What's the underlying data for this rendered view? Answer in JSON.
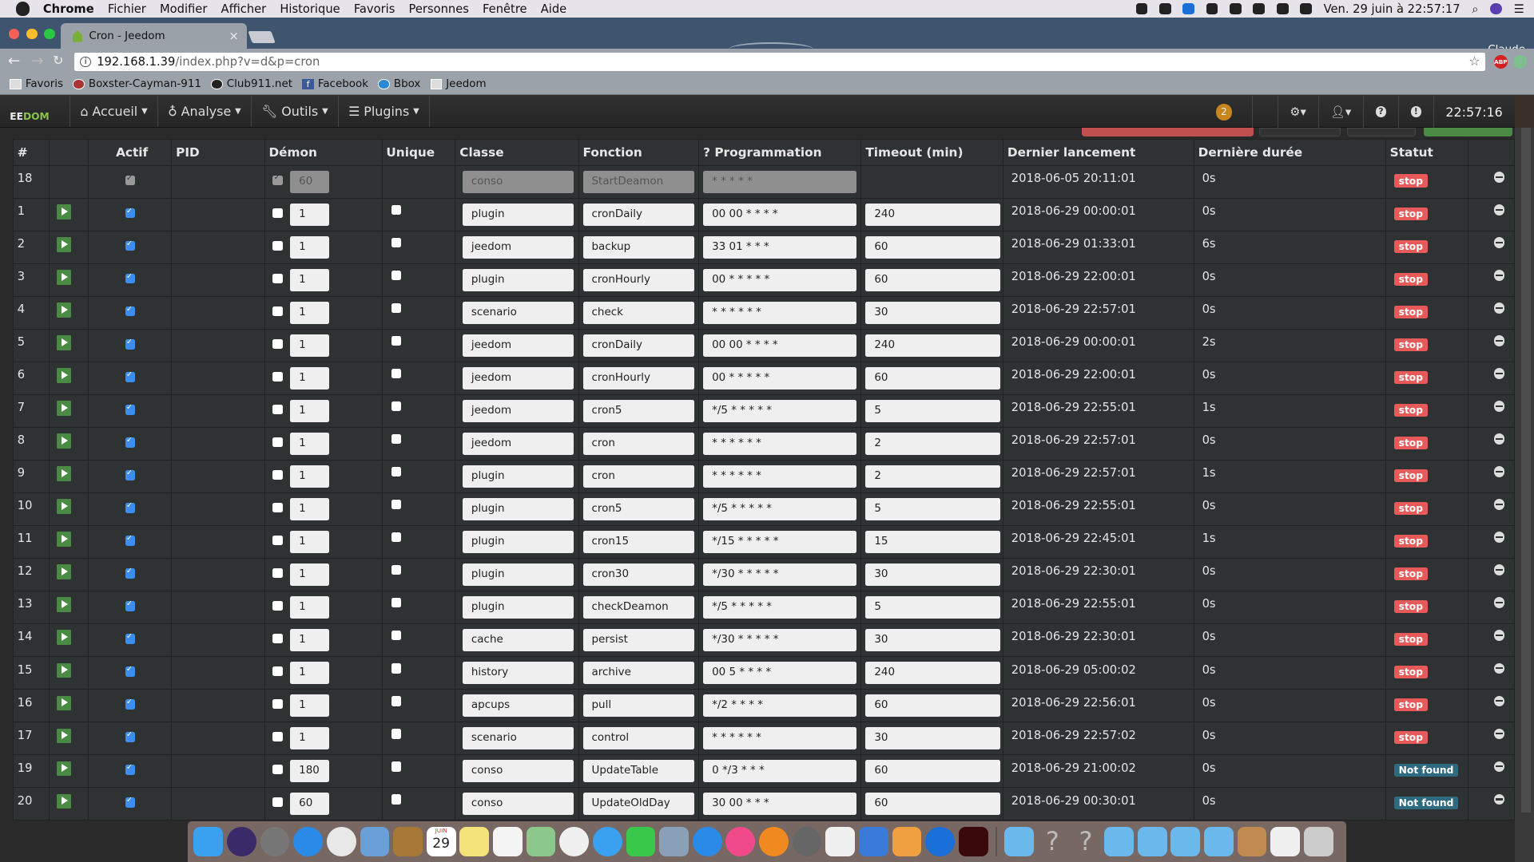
{
  "menubar": {
    "app": "Chrome",
    "items": [
      "Fichier",
      "Modifier",
      "Afficher",
      "Historique",
      "Favoris",
      "Personnes",
      "Fenêtre",
      "Aide"
    ],
    "datetime": "Ven. 29 juin à  22:57:17"
  },
  "browser": {
    "tab_title": "Cron - Jeedom",
    "profile": "Claude",
    "url_host": "192.168.1.39",
    "url_path": "/index.php?v=d&p=cron",
    "extensions": [
      "ABP"
    ],
    "bookmarks": [
      "Favoris",
      "Boxster-Cayman-911",
      "Club911.net",
      "Facebook",
      "Bbox",
      "Jeedom"
    ]
  },
  "jeedom_nav": {
    "logo_a": "EE",
    "logo_b": "DOM",
    "items": [
      "Accueil",
      "Analyse",
      "Outils",
      "Plugins"
    ],
    "notification_count": "2",
    "clock": "22:57:16"
  },
  "colors": {
    "accent": "#8bc34a",
    "stop": "#e85a5a",
    "not_found": "#2e6a80",
    "play": "#4a8a44"
  },
  "table": {
    "headers": [
      "#",
      "",
      "Actif",
      "PID",
      "Démon",
      "Unique",
      "Classe",
      "Fonction",
      "Programmation",
      "Timeout (min)",
      "Dernier lancement",
      "Dernière durée",
      "Statut",
      ""
    ],
    "rows": [
      {
        "id": "18",
        "actif": true,
        "demon": true,
        "demon_val": "60",
        "unique": false,
        "classe": "conso",
        "fonction": "StartDeamon",
        "prog": "* * * * *",
        "timeout": "",
        "last": "2018-06-05 20:11:01",
        "duration": "0s",
        "status": "stop",
        "disabled": true
      },
      {
        "id": "1",
        "actif": true,
        "demon": false,
        "demon_val": "1",
        "unique": false,
        "classe": "plugin",
        "fonction": "cronDaily",
        "prog": "00 00 * * * *",
        "timeout": "240",
        "last": "2018-06-29 00:00:01",
        "duration": "0s",
        "status": "stop"
      },
      {
        "id": "2",
        "actif": true,
        "demon": false,
        "demon_val": "1",
        "unique": false,
        "classe": "jeedom",
        "fonction": "backup",
        "prog": "33 01 * * *",
        "timeout": "60",
        "last": "2018-06-29 01:33:01",
        "duration": "6s",
        "status": "stop"
      },
      {
        "id": "3",
        "actif": true,
        "demon": false,
        "demon_val": "1",
        "unique": false,
        "classe": "plugin",
        "fonction": "cronHourly",
        "prog": "00 * * * * *",
        "timeout": "60",
        "last": "2018-06-29 22:00:01",
        "duration": "0s",
        "status": "stop"
      },
      {
        "id": "4",
        "actif": true,
        "demon": false,
        "demon_val": "1",
        "unique": false,
        "classe": "scenario",
        "fonction": "check",
        "prog": "* * * * * *",
        "timeout": "30",
        "last": "2018-06-29 22:57:01",
        "duration": "0s",
        "status": "stop"
      },
      {
        "id": "5",
        "actif": true,
        "demon": false,
        "demon_val": "1",
        "unique": false,
        "classe": "jeedom",
        "fonction": "cronDaily",
        "prog": "00 00 * * * *",
        "timeout": "240",
        "last": "2018-06-29 00:00:01",
        "duration": "2s",
        "status": "stop"
      },
      {
        "id": "6",
        "actif": true,
        "demon": false,
        "demon_val": "1",
        "unique": false,
        "classe": "jeedom",
        "fonction": "cronHourly",
        "prog": "00 * * * * *",
        "timeout": "60",
        "last": "2018-06-29 22:00:01",
        "duration": "0s",
        "status": "stop"
      },
      {
        "id": "7",
        "actif": true,
        "demon": false,
        "demon_val": "1",
        "unique": false,
        "classe": "jeedom",
        "fonction": "cron5",
        "prog": "*/5 * * * * *",
        "timeout": "5",
        "last": "2018-06-29 22:55:01",
        "duration": "1s",
        "status": "stop"
      },
      {
        "id": "8",
        "actif": true,
        "demon": false,
        "demon_val": "1",
        "unique": false,
        "classe": "jeedom",
        "fonction": "cron",
        "prog": "* * * * * *",
        "timeout": "2",
        "last": "2018-06-29 22:57:01",
        "duration": "0s",
        "status": "stop"
      },
      {
        "id": "9",
        "actif": true,
        "demon": false,
        "demon_val": "1",
        "unique": false,
        "classe": "plugin",
        "fonction": "cron",
        "prog": "* * * * * *",
        "timeout": "2",
        "last": "2018-06-29 22:57:01",
        "duration": "1s",
        "status": "stop"
      },
      {
        "id": "10",
        "actif": true,
        "demon": false,
        "demon_val": "1",
        "unique": false,
        "classe": "plugin",
        "fonction": "cron5",
        "prog": "*/5 * * * * *",
        "timeout": "5",
        "last": "2018-06-29 22:55:01",
        "duration": "0s",
        "status": "stop"
      },
      {
        "id": "11",
        "actif": true,
        "demon": false,
        "demon_val": "1",
        "unique": false,
        "classe": "plugin",
        "fonction": "cron15",
        "prog": "*/15 * * * * *",
        "timeout": "15",
        "last": "2018-06-29 22:45:01",
        "duration": "1s",
        "status": "stop"
      },
      {
        "id": "12",
        "actif": true,
        "demon": false,
        "demon_val": "1",
        "unique": false,
        "classe": "plugin",
        "fonction": "cron30",
        "prog": "*/30 * * * * *",
        "timeout": "30",
        "last": "2018-06-29 22:30:01",
        "duration": "0s",
        "status": "stop"
      },
      {
        "id": "13",
        "actif": true,
        "demon": false,
        "demon_val": "1",
        "unique": false,
        "classe": "plugin",
        "fonction": "checkDeamon",
        "prog": "*/5 * * * * *",
        "timeout": "5",
        "last": "2018-06-29 22:55:01",
        "duration": "0s",
        "status": "stop"
      },
      {
        "id": "14",
        "actif": true,
        "demon": false,
        "demon_val": "1",
        "unique": false,
        "classe": "cache",
        "fonction": "persist",
        "prog": "*/30 * * * * *",
        "timeout": "30",
        "last": "2018-06-29 22:30:01",
        "duration": "0s",
        "status": "stop"
      },
      {
        "id": "15",
        "actif": true,
        "demon": false,
        "demon_val": "1",
        "unique": false,
        "classe": "history",
        "fonction": "archive",
        "prog": "00 5 * * * *",
        "timeout": "240",
        "last": "2018-06-29 05:00:02",
        "duration": "0s",
        "status": "stop"
      },
      {
        "id": "16",
        "actif": true,
        "demon": false,
        "demon_val": "1",
        "unique": false,
        "classe": "apcups",
        "fonction": "pull",
        "prog": "*/2 * * * *",
        "timeout": "60",
        "last": "2018-06-29 22:56:01",
        "duration": "0s",
        "status": "stop"
      },
      {
        "id": "17",
        "actif": true,
        "demon": false,
        "demon_val": "1",
        "unique": false,
        "classe": "scenario",
        "fonction": "control",
        "prog": "* * * * * *",
        "timeout": "30",
        "last": "2018-06-29 22:57:02",
        "duration": "0s",
        "status": "stop"
      },
      {
        "id": "19",
        "actif": true,
        "demon": false,
        "demon_val": "180",
        "unique": false,
        "classe": "conso",
        "fonction": "UpdateTable",
        "prog": "0 */3 * * *",
        "timeout": "60",
        "last": "2018-06-29 21:00:02",
        "duration": "0s",
        "status": "Not found"
      },
      {
        "id": "20",
        "actif": true,
        "demon": false,
        "demon_val": "60",
        "unique": false,
        "classe": "conso",
        "fonction": "UpdateOldDay",
        "prog": "30 00 * * *",
        "timeout": "60",
        "last": "2018-06-29 00:30:01",
        "duration": "0s",
        "status": "Not found"
      }
    ]
  },
  "dock": {
    "calendar_month": "JUIN",
    "calendar_day": "29",
    "apps": [
      "finder",
      "siri",
      "launchpad",
      "safari",
      "chrome",
      "mail",
      "contacts",
      "calendar",
      "notes",
      "reminders",
      "maps",
      "photos",
      "messages",
      "facetime",
      "preview",
      "app-store",
      "itunes",
      "ibooks",
      "system-preferences",
      "numbers",
      "keynote",
      "pages",
      "teamviewer",
      "acrobat",
      "folder",
      "unknown",
      "unknown",
      "documents",
      "films",
      "music",
      "pictures",
      "home",
      "screenshot",
      "trash"
    ]
  }
}
